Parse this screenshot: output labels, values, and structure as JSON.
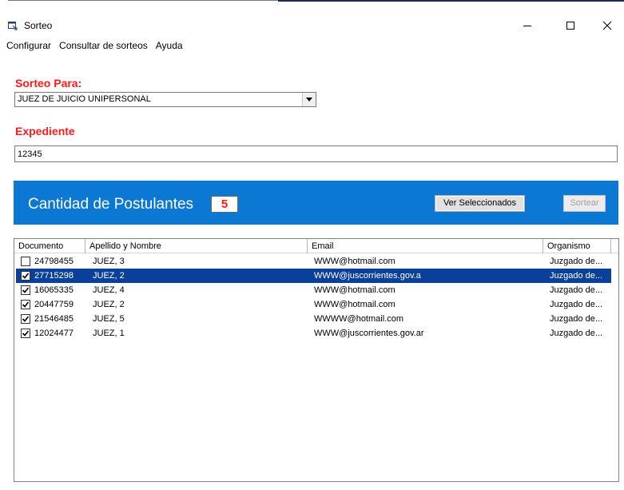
{
  "window": {
    "title": "Sorteo",
    "controls": {
      "minimize": "—",
      "maximize": "☐",
      "close": "✕"
    }
  },
  "menu": [
    {
      "label": "Configurar"
    },
    {
      "label": "Consultar de sorteos"
    },
    {
      "label": "Ayuda"
    }
  ],
  "form": {
    "sorteo_label": "Sorteo Para:",
    "sorteo_value": "JUEZ DE JUICIO UNIPERSONAL",
    "expediente_label": "Expediente",
    "expediente_value": "12345"
  },
  "panel": {
    "title": "Cantidad de Postulantes",
    "count": "5",
    "ver_button": "Ver Seleccionados",
    "sortear_button": "Sortear"
  },
  "table": {
    "columns": [
      "Documento",
      "Apellido y Nombre",
      "Email",
      "Organismo"
    ],
    "rows": [
      {
        "documento": "24798455",
        "nombre": "JUEZ, 3",
        "email": "WWW@hotmail.com",
        "organismo": "Juzgado de...",
        "checked": false,
        "selected": false
      },
      {
        "documento": "27715298",
        "nombre": "JUEZ, 2",
        "email": "WWW@juscorrientes.gov.a",
        "organismo": "Juzgado de...",
        "checked": true,
        "selected": true
      },
      {
        "documento": "16065335",
        "nombre": "JUEZ, 4",
        "email": "WWW@hotmail.com",
        "organismo": "Juzgado de...",
        "checked": true,
        "selected": false
      },
      {
        "documento": "20447759",
        "nombre": "JUEZ, 2",
        "email": "WWW@hotmail.com",
        "organismo": "Juzgado de...",
        "checked": true,
        "selected": false
      },
      {
        "documento": "21546485",
        "nombre": "JUEZ, 5",
        "email": "WWWW@hotmail.com",
        "organismo": "Juzgado de...",
        "checked": true,
        "selected": false
      },
      {
        "documento": "12024477",
        "nombre": "JUEZ, 1",
        "email": "WWW@juscorrientes.gov.ar",
        "organismo": "Juzgado de...",
        "checked": true,
        "selected": false
      }
    ]
  },
  "colors": {
    "accent_panel": "#0b78d4",
    "label_red": "#ff1a1a",
    "selection": "#0a3f9a"
  }
}
